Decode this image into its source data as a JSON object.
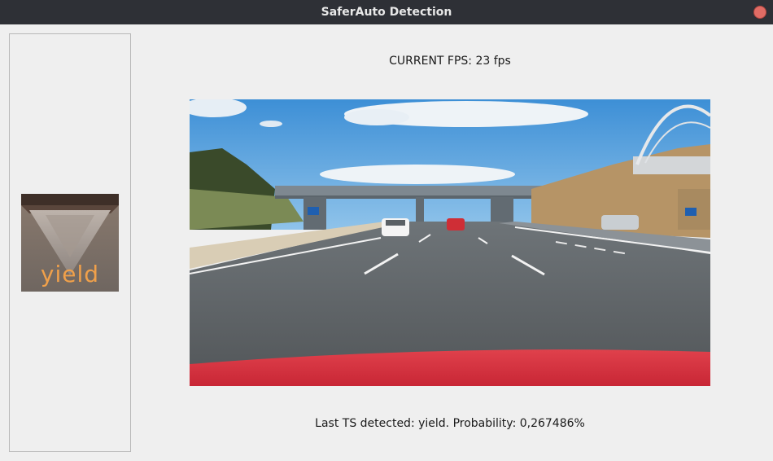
{
  "window": {
    "title": "SaferAuto Detection"
  },
  "fps": {
    "text": "CURRENT FPS: 23 fps",
    "value": 23
  },
  "detection": {
    "thumbnail_label": "yield",
    "status_text": "Last TS detected: yield. Probability: 0,267486%"
  },
  "colors": {
    "titlebar": "#2e3036",
    "close": "#e06c65",
    "label_orange": "#f0a04a",
    "car_hood": "#d8303c"
  },
  "icons": {
    "close": "close-icon"
  }
}
